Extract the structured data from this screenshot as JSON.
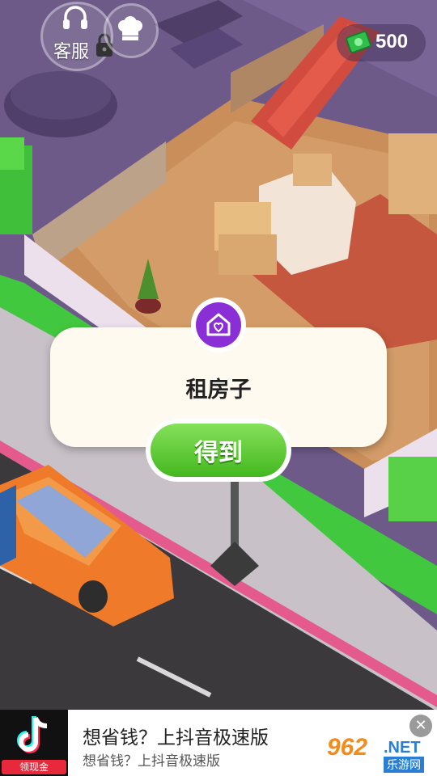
{
  "hud": {
    "customer_service_label": "客服",
    "cash_amount": "500"
  },
  "dialog": {
    "title": "租房子",
    "get_button_label": "得到"
  },
  "ad": {
    "title": "想省钱？上抖音极速版",
    "subtitle": "想省钱？上抖音极速版",
    "badge": "领现金",
    "close_label": "✕"
  },
  "watermark": {
    "number": "962",
    "suffix": ".NET",
    "site": "乐游网"
  },
  "colors": {
    "accent_purple": "#8a2fd6",
    "button_green": "#43b81f",
    "cash_green": "#2fbf4a"
  },
  "icons": [
    "headset-icon",
    "lock-icon",
    "chef-hat-icon",
    "cash-icon",
    "house-heart-icon",
    "close-icon"
  ]
}
